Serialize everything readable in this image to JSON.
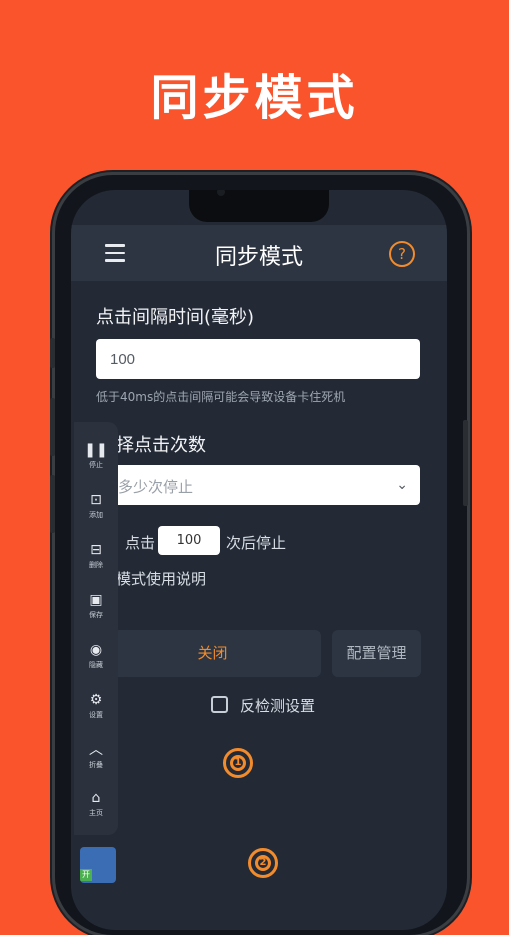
{
  "hero": {
    "title": "同步模式"
  },
  "appbar": {
    "title": "同步模式",
    "menu_icon": "menu-icon",
    "help_icon": "help-icon",
    "help_glyph": "?"
  },
  "interval": {
    "label": "点击间隔时间(毫秒)",
    "value": "100",
    "hint": "低于40ms的点击间隔可能会导致设备卡住死机"
  },
  "click_count": {
    "label": "择点击次数",
    "select_value": "多少次停止",
    "chevron": "⌄",
    "prefix": "点击",
    "count_value": "100",
    "suffix": "次后停止"
  },
  "mode_help": {
    "text": "模式使用说明"
  },
  "buttons": {
    "close": "关闭",
    "config": "配置管理"
  },
  "anti_detect": {
    "label": "反检测设置",
    "checked": false
  },
  "targets": [
    {
      "number": "1"
    },
    {
      "number": "2"
    }
  ],
  "toolbar": {
    "items": [
      {
        "icon": "pause-icon",
        "glyph": "❚❚",
        "label": "停止"
      },
      {
        "icon": "add-target-icon",
        "glyph": "⊡",
        "label": "添加"
      },
      {
        "icon": "remove-target-icon",
        "glyph": "⊟",
        "label": "删除"
      },
      {
        "icon": "save-icon",
        "glyph": "▣",
        "label": "保存"
      },
      {
        "icon": "hide-icon",
        "glyph": "◉",
        "label": "隐藏"
      },
      {
        "icon": "settings-icon",
        "glyph": "⚙",
        "label": "设置"
      },
      {
        "icon": "collapse-icon",
        "glyph": "︿",
        "label": "折叠"
      },
      {
        "icon": "home-icon",
        "glyph": "⌂",
        "label": "主页"
      }
    ]
  },
  "app_thumbnail": {
    "badge": "开"
  },
  "colors": {
    "background": "#f9542c",
    "accent": "#f28b2c",
    "screen": "#232a36"
  }
}
